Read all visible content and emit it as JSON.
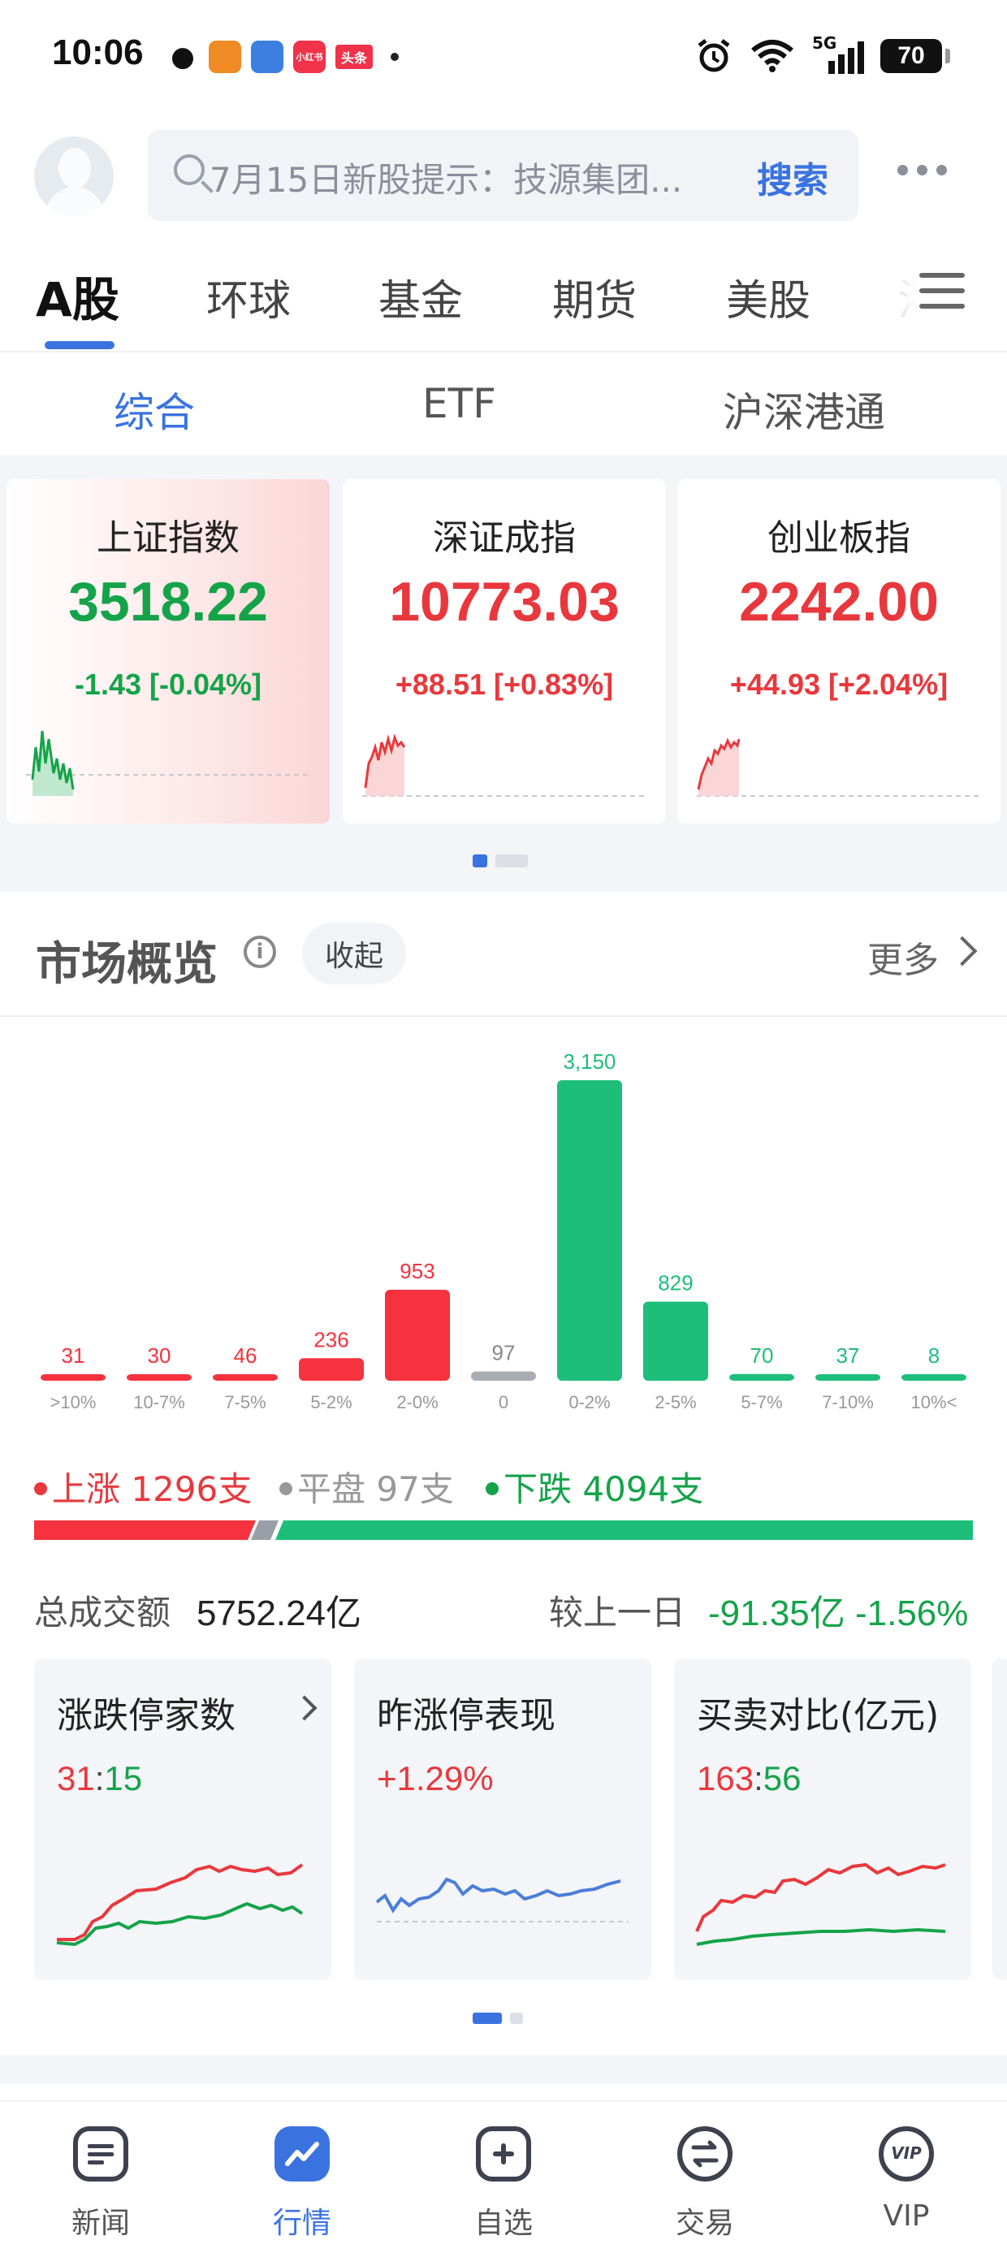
{
  "status_bar": {
    "time": "10:06",
    "apps": [
      "wechat-icon",
      "app-icon",
      "app-icon",
      "小红书",
      "头条"
    ],
    "xiaohongshu": "小红书",
    "toutiao": "头条",
    "network": "5G",
    "battery": "70"
  },
  "header": {
    "search_placeholder": "7月15日新股提示：技源集团...",
    "search_button": "搜索"
  },
  "market_tabs": [
    "A股",
    "环球",
    "基金",
    "期货",
    "美股",
    "港"
  ],
  "sub_tabs": [
    "综合",
    "ETF",
    "沪深港通"
  ],
  "indices": [
    {
      "name": "上证指数",
      "value": "3518.22",
      "change": "-1.43 [-0.04%]",
      "trend": "down"
    },
    {
      "name": "深证成指",
      "value": "10773.03",
      "change": "+88.51 [+0.83%]",
      "trend": "up"
    },
    {
      "name": "创业板指",
      "value": "2242.00",
      "change": "+44.93 [+2.04%]",
      "trend": "up"
    }
  ],
  "overview": {
    "title": "市场概览",
    "collapse_label": "收起",
    "more_label": "更多"
  },
  "chart_data": {
    "type": "bar",
    "categories": [
      ">10%",
      "10-7%",
      "7-5%",
      "5-2%",
      "2-0%",
      "0",
      "0-2%",
      "2-5%",
      "5-7%",
      "7-10%",
      "10%<"
    ],
    "values": [
      31,
      30,
      46,
      236,
      953,
      97,
      3150,
      829,
      70,
      37,
      8
    ],
    "value_labels": [
      "31",
      "30",
      "46",
      "236",
      "953",
      "97",
      "3,150",
      "829",
      "70",
      "37",
      "8"
    ],
    "bar_colors": [
      "#f5323e",
      "#f5323e",
      "#f5323e",
      "#f5323e",
      "#f5323e",
      "#a8acb4",
      "#1dbe7a",
      "#1dbe7a",
      "#1dbe7a",
      "#1dbe7a",
      "#1dbe7a"
    ]
  },
  "breadth": {
    "up_label": "上涨 1296支",
    "flat_label": "平盘 97支",
    "down_label": "下跌 4094支",
    "up": 1296,
    "flat": 97,
    "down": 4094
  },
  "turnover": {
    "label": "总成交额",
    "value": "5752.24亿",
    "cmp_label": "较上一日",
    "cmp_value": "-91.35亿 -1.56%"
  },
  "stat_cards": [
    {
      "title": "涨跌停家数",
      "value_a": "31",
      "sep": ":",
      "value_b": "15"
    },
    {
      "title": "昨涨停表现",
      "value": "+1.29%"
    },
    {
      "title": "买卖对比(亿元)",
      "value_a": "163",
      "sep": ":",
      "value_b": "56"
    }
  ],
  "bottom_nav": [
    "新闻",
    "行情",
    "自选",
    "交易",
    "VIP"
  ],
  "colors": {
    "accent": "#3a73e0",
    "up": "#e8383d",
    "down": "#15a34a"
  }
}
